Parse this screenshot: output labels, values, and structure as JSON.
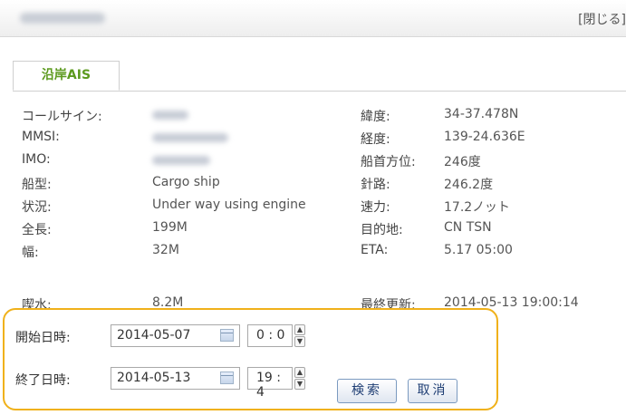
{
  "header": {
    "close_label": "[閉じる]"
  },
  "tabs": [
    {
      "label": "沿岸AIS"
    }
  ],
  "info": {
    "left": [
      {
        "label": "コールサイン:",
        "value": ""
      },
      {
        "label": "MMSI:",
        "value": ""
      },
      {
        "label": "IMO:",
        "value": ""
      },
      {
        "label": "船型:",
        "value": "Cargo ship"
      },
      {
        "label": "状況:",
        "value": "Under way using engine"
      },
      {
        "label": "全長:",
        "value": "199M"
      },
      {
        "label": "幅:",
        "value": "32M"
      },
      {
        "label": "喫水:",
        "value": "8.2M"
      }
    ],
    "right": [
      {
        "label": "緯度:",
        "value": "34-37.478N"
      },
      {
        "label": "経度:",
        "value": "139-24.636E"
      },
      {
        "label": "船首方位:",
        "value": "246度"
      },
      {
        "label": "針路:",
        "value": "246.2度"
      },
      {
        "label": "速力:",
        "value": "17.2ノット"
      },
      {
        "label": "目的地:",
        "value": "CN TSN"
      },
      {
        "label": "ETA:",
        "value": "5.17 05:00"
      },
      {
        "label": "最終更新:",
        "value": "2014-05-13 19:00:14"
      }
    ]
  },
  "search": {
    "start": {
      "label": "開始日時:",
      "date": "2014-05-07",
      "time": "0 : 0"
    },
    "end": {
      "label": "終了日時:",
      "date": "2014-05-13",
      "time": "19 : 4"
    },
    "search_button": "検索",
    "cancel_button": "取消"
  },
  "colors": {
    "accent_tab": "#5c9a1e",
    "panel_border": "#f0b11a",
    "button_text": "#1f3e74"
  }
}
